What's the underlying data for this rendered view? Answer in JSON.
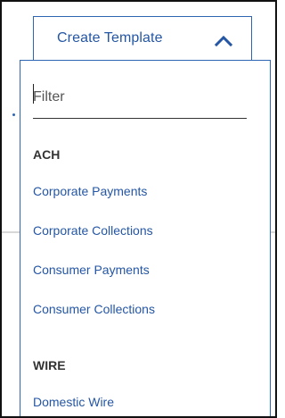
{
  "trigger": {
    "label": "Create Template",
    "chevron_icon": "chevron-up-icon"
  },
  "filter": {
    "placeholder": "Filter",
    "value": ""
  },
  "groups": [
    {
      "label": "ACH",
      "items": [
        "Corporate Payments",
        "Corporate Collections",
        "Consumer Payments",
        "Consumer Collections"
      ]
    },
    {
      "label": "WIRE",
      "items": [
        "Domestic Wire"
      ]
    }
  ],
  "colors": {
    "accent": "#2f66b3",
    "link": "#2456a4",
    "heading": "#333333"
  }
}
